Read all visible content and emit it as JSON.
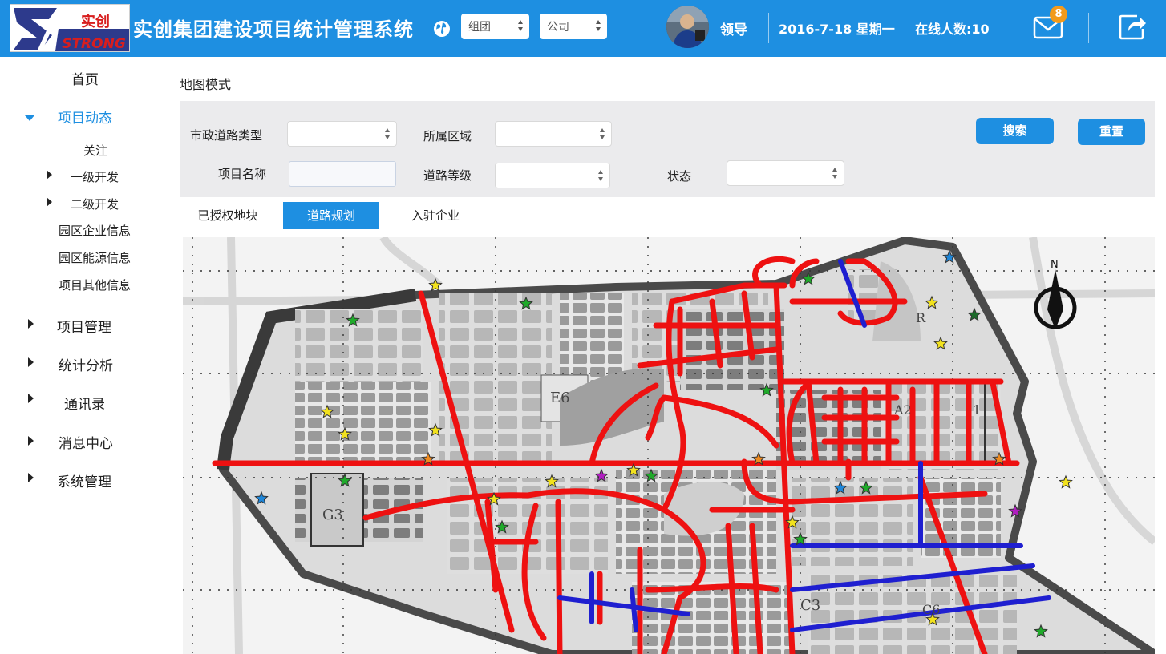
{
  "header": {
    "logo_cn": "实创",
    "logo_en": "STRONG",
    "title": "实创集团建设项目统计管理系统",
    "group_select": "组团",
    "company_select": "公司",
    "user_name": "领导",
    "date": "2016-7-18 星期一",
    "online": "在线人数:10",
    "mail_count": "8"
  },
  "sidebar": {
    "home": "首页",
    "project_dynamics": "项目动态",
    "focus": "关注",
    "level1": "一级开发",
    "level2": "二级开发",
    "park_enterprise": "园区企业信息",
    "park_energy": "园区能源信息",
    "project_other": "项目其他信息",
    "project_mgmt": "项目管理",
    "stats": "统计分析",
    "contacts": "通讯录",
    "messages": "消息中心",
    "system": "系统管理"
  },
  "main": {
    "page_title": "地图模式",
    "filters": {
      "road_type": "市政道路类型",
      "region": "所属区域",
      "project_name": "项目名称",
      "road_level": "道路等级",
      "status": "状态"
    },
    "search_button": "搜索",
    "reset_button": "重置",
    "tabs": [
      "已授权地块",
      "道路规划",
      "入驻企业"
    ]
  },
  "map": {
    "labels": [
      "E6",
      "A2",
      "1",
      "G3",
      "C3",
      "C6",
      "R"
    ],
    "north": "N",
    "colors": {
      "road_planned": "#ee1111",
      "road_other": "#1f1fd0",
      "accent": "#1e8fe1"
    }
  }
}
